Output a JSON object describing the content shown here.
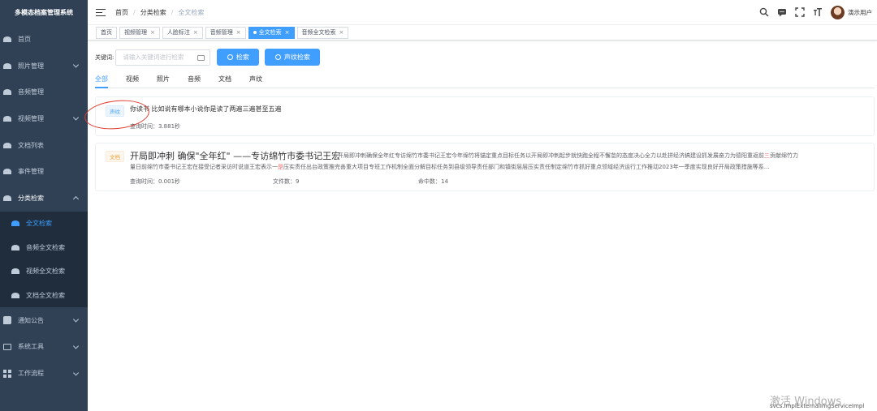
{
  "sidebar": {
    "title": "多模态档案管理系统",
    "items": [
      {
        "label": "首页",
        "icon": "dashboard-icon"
      },
      {
        "label": "照片管理",
        "icon": "photo-icon"
      },
      {
        "label": "音频管理",
        "icon": "audio-icon"
      },
      {
        "label": "视频管理",
        "icon": "video-icon"
      },
      {
        "label": "文档列表",
        "icon": "document-icon"
      },
      {
        "label": "事件管理",
        "icon": "event-icon"
      },
      {
        "label": "分类检索",
        "icon": "category-icon"
      }
    ],
    "sub_items": [
      {
        "label": "全文检索",
        "active": true
      },
      {
        "label": "音频全文检索"
      },
      {
        "label": "视频全文检索"
      },
      {
        "label": "文档全文检索"
      }
    ],
    "bottom_items": [
      {
        "label": "通知公告",
        "icon": "notice-icon"
      },
      {
        "label": "系统工具",
        "icon": "tool-icon"
      },
      {
        "label": "工作流程",
        "icon": "workflow-icon"
      }
    ]
  },
  "navbar": {
    "breadcrumb": [
      "首页",
      "分类检索",
      "全文检索"
    ],
    "user_name": "演示用户"
  },
  "tags": [
    {
      "label": "首页",
      "closable": false
    },
    {
      "label": "视频管理",
      "closable": true
    },
    {
      "label": "人脸标注",
      "closable": true
    },
    {
      "label": "音频管理",
      "closable": true
    },
    {
      "label": "全文检索",
      "closable": true,
      "active": true
    },
    {
      "label": "音频全文检索",
      "closable": true
    }
  ],
  "search": {
    "label": "关键词:",
    "placeholder": "请输入关键词进行检索",
    "search_button": "检索",
    "voice_button": "声纹检索"
  },
  "tabs": [
    "全部",
    "视频",
    "照片",
    "音频",
    "文档",
    "声纹"
  ],
  "results": [
    {
      "tag": "声纹",
      "text": "你读书 比如说有哪本小说你是读了两遍三遍甚至五遍",
      "query_time": "查询时间：3.881秒"
    },
    {
      "tag": "文档",
      "title": "开局即冲刺 确保\"全年红\" ——专访绵竹市委书记王宏",
      "content_line1_a": "开局即冲刺确保全年红专访绵竹市委书记王宏今年绵竹将锚定重点目标任务以开局即冲刺起步就快跑全程不懈怠的态度决心全力以赴拼经济搞建设抓发展奋力为德阳重返前",
      "content_line1_hl": "三",
      "content_line1_b": "贡献绵竹力",
      "content_line2_a": "量日前绵竹市委书记王宏在接受记者采访时说道王宏表示一",
      "content_line2_hl": "是",
      "content_line2_b": "压实责任出台政策推完善重大项目专班工作机制全面分解目标任务到县级领导责任部门和镇街层层压实责任制定绵竹市抓好重点领域经济运行工作推动2023年一季度实现良好开局政策措施等系…",
      "query_time": "查询时间：0.001秒",
      "file_count": "文件数：9",
      "hit_count": "命中数：14"
    }
  ],
  "watermark": {
    "line1": "激活 Windows",
    "line2": "svcs.ImplExternalImgServiceImpl"
  }
}
